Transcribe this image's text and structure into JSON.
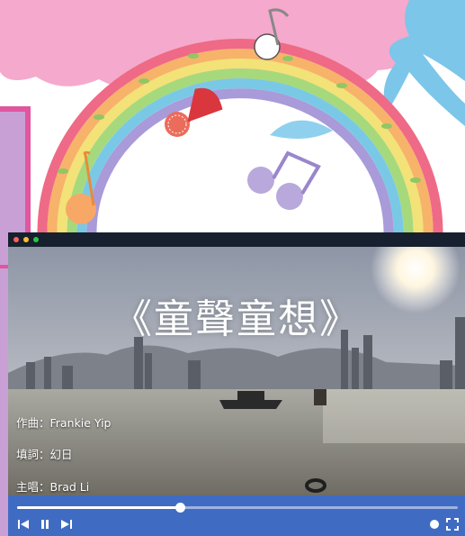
{
  "player": {
    "video_title": "《童聲童想》",
    "credits": [
      "作曲：Frankie Yip",
      "填詞：幻日",
      "主唱：Brad Li"
    ],
    "progress_fraction": 0.37,
    "window_dots": [
      "#ff5f57",
      "#febc2e",
      "#28c840"
    ]
  },
  "controls": {
    "previous": "previous-icon",
    "pause": "pause-icon",
    "next": "next-icon",
    "volume": "volume-dot-icon",
    "fullscreen": "fullscreen-icon"
  },
  "colors": {
    "control_bar": "#3f6cc2",
    "cloud": "#f5a9cc",
    "rainbow": [
      "#ef6a86",
      "#f7b36a",
      "#f2e277",
      "#a6d97c",
      "#79c9e6",
      "#a99ad9"
    ]
  }
}
